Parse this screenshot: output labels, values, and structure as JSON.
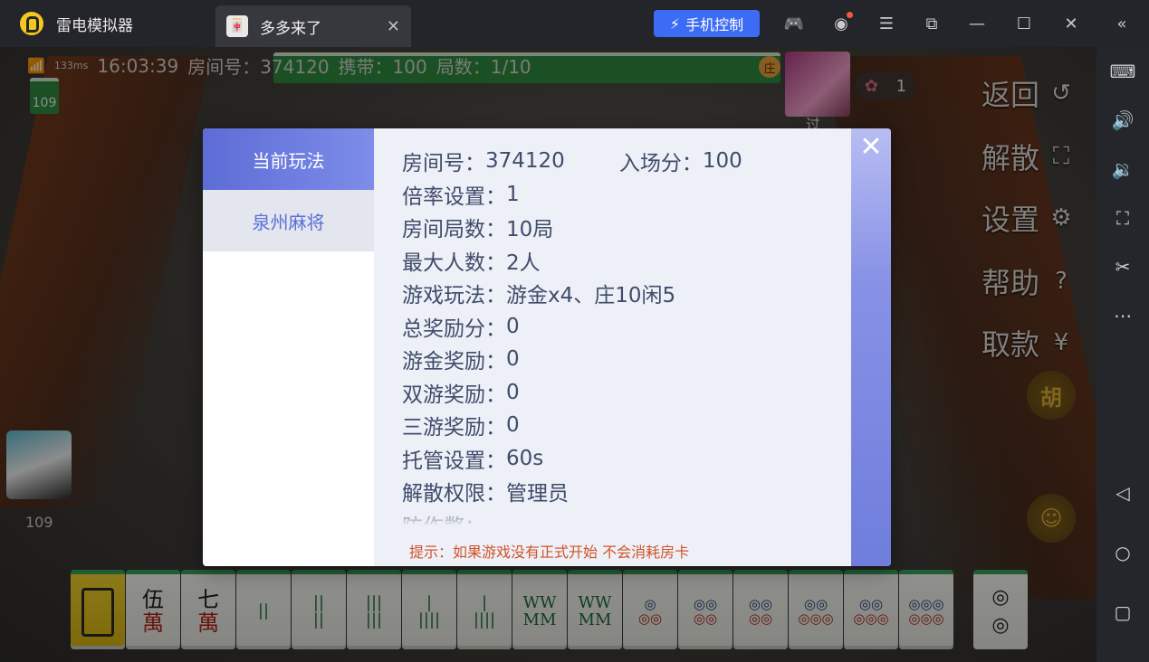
{
  "titlebar": {
    "app_title": "雷电模拟器",
    "tab_label": "多多来了",
    "tab_close": "✕",
    "phone_control": "手机控制"
  },
  "status": {
    "ping": "133ms",
    "time": "16:03:39",
    "room": "房间号：374120",
    "carry": "携带：100",
    "rounds": "局数：1/10",
    "remaining": "109",
    "dealer": "庄",
    "pass": "过",
    "flower_count": "1",
    "my_score": "109"
  },
  "side_buttons": [
    {
      "label": "返回",
      "icon": "back-icon"
    },
    {
      "label": "解散",
      "icon": "dissolve-icon"
    },
    {
      "label": "设置",
      "icon": "gear-icon"
    },
    {
      "label": "帮助",
      "icon": "help-icon"
    },
    {
      "label": "取款",
      "icon": "withdraw-icon"
    }
  ],
  "round_buttons": {
    "hu": "胡"
  },
  "hand_tiles": [
    {
      "top": "",
      "bottom": "",
      "kind": "gold"
    },
    {
      "top": "伍",
      "bottom": "萬",
      "kind": "wan"
    },
    {
      "top": "七",
      "bottom": "萬",
      "kind": "wan"
    },
    {
      "top": "||",
      "bottom": "",
      "kind": "tiao"
    },
    {
      "top": "||",
      "bottom": "||",
      "kind": "tiao"
    },
    {
      "top": "|||",
      "bottom": "|||",
      "kind": "tiao"
    },
    {
      "top": "|",
      "bottom": "||||",
      "kind": "tiao"
    },
    {
      "top": "|",
      "bottom": "||||",
      "kind": "tiao"
    },
    {
      "top": "WW",
      "bottom": "MM",
      "kind": "tiao"
    },
    {
      "top": "WW",
      "bottom": "MM",
      "kind": "tiao"
    },
    {
      "top": "◎",
      "bottom": "◎◎",
      "kind": "tong"
    },
    {
      "top": "◎◎",
      "bottom": "◎◎",
      "kind": "tong"
    },
    {
      "top": "◎◎",
      "bottom": "◎◎",
      "kind": "tong"
    },
    {
      "top": "◎◎",
      "bottom": "◎◎◎",
      "kind": "tong"
    },
    {
      "top": "◎◎",
      "bottom": "◎◎◎",
      "kind": "tong"
    },
    {
      "top": "◎◎◎",
      "bottom": "◎◎◎",
      "kind": "tong"
    }
  ],
  "drawn_tile": {
    "top": "◎",
    "bottom": "◎"
  },
  "modal": {
    "tab_current": "当前玩法",
    "tab_game": "泉州麻将",
    "close": "✕",
    "rows": [
      {
        "label": "房间号：",
        "value": "374120",
        "label2": "入场分：",
        "value2": "100"
      },
      {
        "label": "倍率设置：",
        "value": "1"
      },
      {
        "label": "房间局数：",
        "value": "10局"
      },
      {
        "label": "最大人数：",
        "value": "2人"
      },
      {
        "label": "游戏玩法：",
        "value": "游金x4、庄10闲5"
      },
      {
        "label": "总奖励分：",
        "value": "0"
      },
      {
        "label": "游金奖励：",
        "value": "0"
      },
      {
        "label": "双游奖励：",
        "value": "0"
      },
      {
        "label": "三游奖励：",
        "value": "0"
      },
      {
        "label": "托管设置：",
        "value": "60s"
      },
      {
        "label": "解散权限：",
        "value": "管理员"
      },
      {
        "label": "防作弊：",
        "value": ""
      }
    ],
    "tip": "提示：如果游戏没有正式开始 不会消耗房卡"
  }
}
